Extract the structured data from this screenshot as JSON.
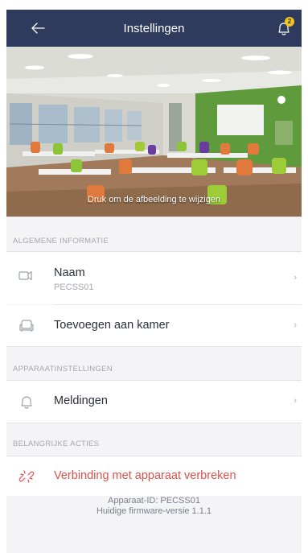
{
  "header": {
    "title": "Instellingen",
    "back_icon": "arrow-left-icon",
    "bell_icon": "bell-icon",
    "badge_count": "2"
  },
  "hero": {
    "caption": "Druk om de afbeelding te wijzigen"
  },
  "sections": {
    "general": "ALGEMENE INFORMATIE",
    "device_settings": "APPARAATINSTELLINGEN",
    "important_actions": "BELANGRIJKE ACTIES"
  },
  "rows": {
    "name": {
      "label": "Naam",
      "value": "PECSS01",
      "icon": "device-icon"
    },
    "add_room": {
      "label": "Toevoegen aan kamer",
      "icon": "armchair-icon"
    },
    "notifications": {
      "label": "Meldingen",
      "icon": "bell-icon"
    },
    "disconnect": {
      "label": "Verbinding met apparaat verbreken",
      "icon": "unlink-icon"
    }
  },
  "chevron": "›",
  "footer": {
    "device_id": "Apparaat-ID: PECSS01",
    "firmware": "Huidige firmware-versie 1.1.1"
  },
  "colors": {
    "header_bg": "#2e3b5c",
    "badge": "#f4c31a",
    "danger": "#e0504a"
  }
}
